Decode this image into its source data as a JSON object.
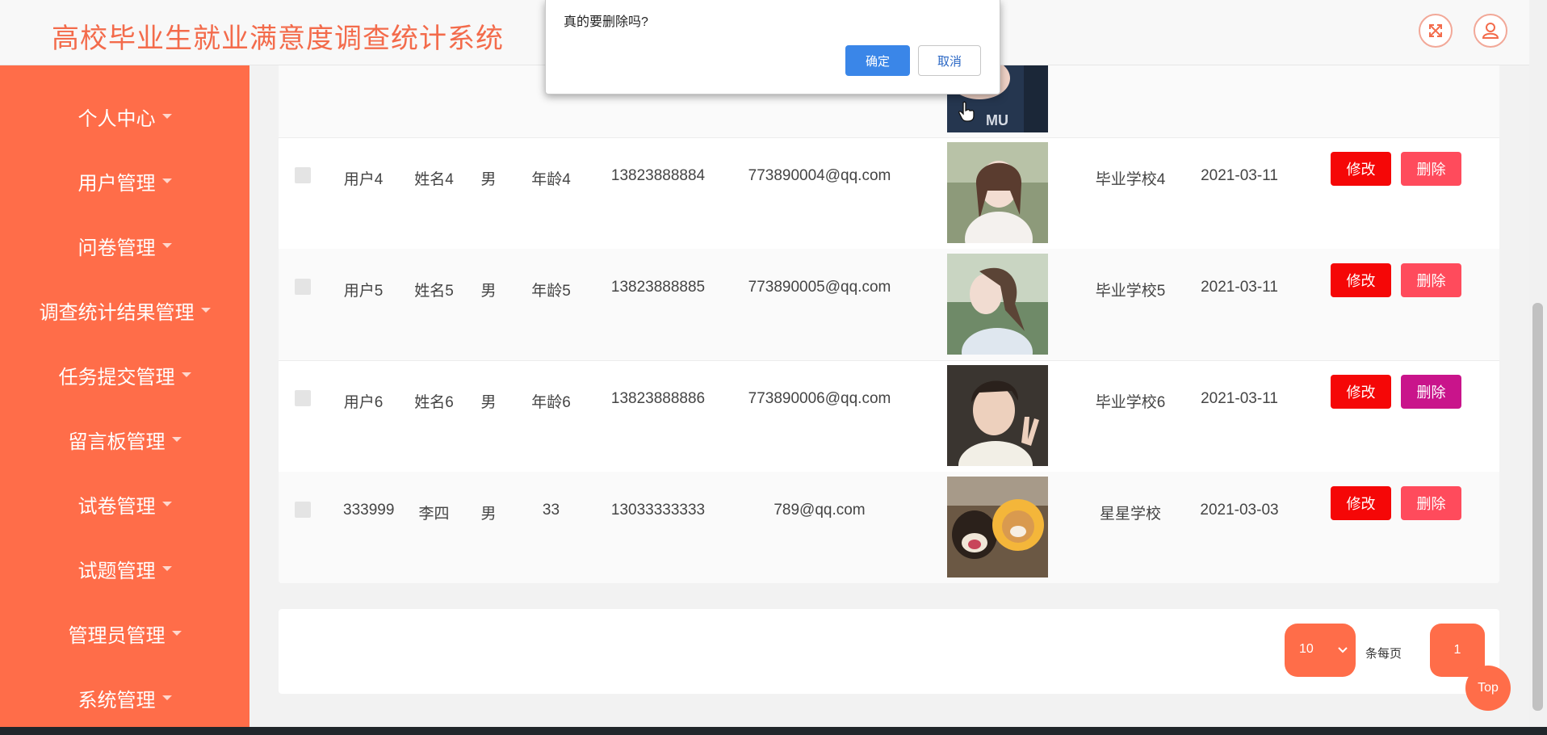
{
  "header": {
    "title": "高校毕业生就业满意度调查统计系统"
  },
  "sidebar": {
    "items": [
      {
        "label": "个人中心"
      },
      {
        "label": "用户管理"
      },
      {
        "label": "问卷管理"
      },
      {
        "label": "调查统计结果管理"
      },
      {
        "label": "任务提交管理"
      },
      {
        "label": "留言板管理"
      },
      {
        "label": "试卷管理"
      },
      {
        "label": "试题管理"
      },
      {
        "label": "管理员管理"
      },
      {
        "label": "系统管理"
      }
    ]
  },
  "table": {
    "edit_label": "修改",
    "delete_label": "删除",
    "rows": [
      {
        "account": "",
        "name": "",
        "gender": "",
        "age": "",
        "phone": "",
        "email": "",
        "school": "",
        "date": "",
        "photo": "photo-partial"
      },
      {
        "account": "用户4",
        "name": "姓名4",
        "gender": "男",
        "age": "年龄4",
        "phone": "13823888884",
        "email": "773890004@qq.com",
        "school": "毕业学校4",
        "date": "2021-03-11",
        "photo": "photo-girl-selfie"
      },
      {
        "account": "用户5",
        "name": "姓名5",
        "gender": "男",
        "age": "年龄5",
        "phone": "13823888885",
        "email": "773890005@qq.com",
        "school": "毕业学校5",
        "date": "2021-03-11",
        "photo": "photo-girl-profile"
      },
      {
        "account": "用户6",
        "name": "姓名6",
        "gender": "男",
        "age": "年龄6",
        "phone": "13823888886",
        "email": "773890006@qq.com",
        "school": "毕业学校6",
        "date": "2021-03-11",
        "photo": "photo-boy-peace"
      },
      {
        "account": "333999",
        "name": "李四",
        "gender": "男",
        "age": "33",
        "phone": "13033333333",
        "email": "789@qq.com",
        "school": "星星学校",
        "date": "2021-03-03",
        "photo": "photo-shiba-dogs"
      }
    ]
  },
  "pagination": {
    "page_size": "10",
    "per_page_label": "条每页",
    "current_page": "1"
  },
  "top_button": {
    "label": "Top"
  },
  "dialog": {
    "message": "真的要删除吗?",
    "ok_label": "确定",
    "cancel_label": "取消"
  },
  "colors": {
    "accent": "#ff6d49",
    "title": "#f36b4b",
    "edit": "#f50707",
    "delete": "#ff4b5c",
    "delete_hover": "#c9148b",
    "dialog_ok": "#3a86e8"
  }
}
